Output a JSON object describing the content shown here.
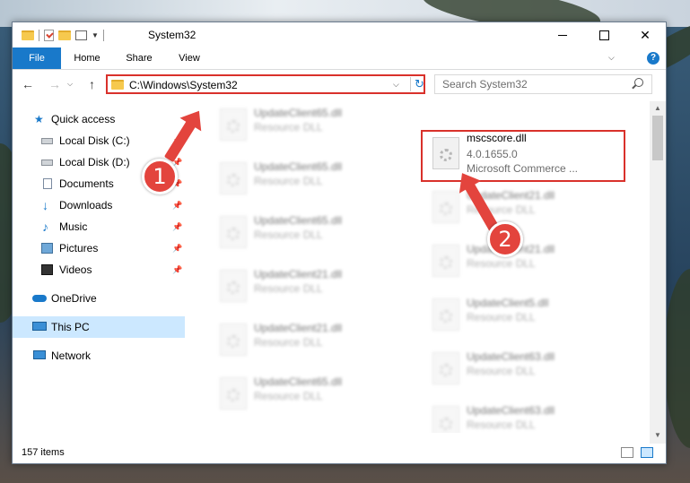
{
  "window": {
    "title": "System32",
    "controls": {
      "minimize": "minimize",
      "maximize": "maximize",
      "close": "✕"
    }
  },
  "ribbon": {
    "tabs": [
      "File",
      "Home",
      "Share",
      "View"
    ]
  },
  "address": {
    "path": "C:\\Windows\\System32",
    "search_placeholder": "Search System32"
  },
  "sidebar": {
    "items": [
      {
        "label": "Quick access",
        "icon": "star-icon"
      },
      {
        "label": "Local Disk (C:)",
        "icon": "drive-icon",
        "pinned": true
      },
      {
        "label": "Local Disk (D:)",
        "icon": "drive-icon",
        "pinned": true
      },
      {
        "label": "Documents",
        "icon": "documents-icon",
        "pinned": true
      },
      {
        "label": "Downloads",
        "icon": "downloads-icon",
        "pinned": true
      },
      {
        "label": "Music",
        "icon": "music-icon",
        "pinned": true
      },
      {
        "label": "Pictures",
        "icon": "pictures-icon",
        "pinned": true
      },
      {
        "label": "Videos",
        "icon": "videos-icon",
        "pinned": true
      },
      {
        "label": "OneDrive",
        "icon": "onedrive-icon"
      },
      {
        "label": "This PC",
        "icon": "this-pc-icon",
        "selected": true
      },
      {
        "label": "Network",
        "icon": "network-icon"
      }
    ]
  },
  "files": {
    "left": [
      {
        "name": "UpdateClient65.dll",
        "type": "Resource DLL"
      },
      {
        "name": "UpdateClient65.dll",
        "type": "Resource DLL"
      },
      {
        "name": "UpdateClient65.dll",
        "type": "Resource DLL"
      },
      {
        "name": "UpdateClient21.dll",
        "type": "Resource DLL"
      },
      {
        "name": "UpdateClient21.dll",
        "type": "Resource DLL"
      },
      {
        "name": "UpdateClient65.dll",
        "type": "Resource DLL"
      }
    ],
    "right": [
      {
        "name": "mscscore.dll",
        "version": "4.0.1655.0",
        "company": "Microsoft Commerce ..."
      },
      {
        "name": "UpdateClient21.dll",
        "type": "Resource DLL"
      },
      {
        "name": "UpdateClient21.dll",
        "type": "Resource DLL"
      },
      {
        "name": "UpdateClient5.dll",
        "type": "Resource DLL"
      },
      {
        "name": "UpdateClient63.dll",
        "type": "Resource DLL"
      },
      {
        "name": "UpdateClient63.dll",
        "type": "Resource DLL"
      }
    ]
  },
  "status": {
    "items_count": "157 items"
  },
  "annotations": {
    "step1": "1",
    "step2": "2"
  },
  "colors": {
    "accent": "#1979ca",
    "highlight": "#d9312b",
    "badge": "#e3443d"
  }
}
